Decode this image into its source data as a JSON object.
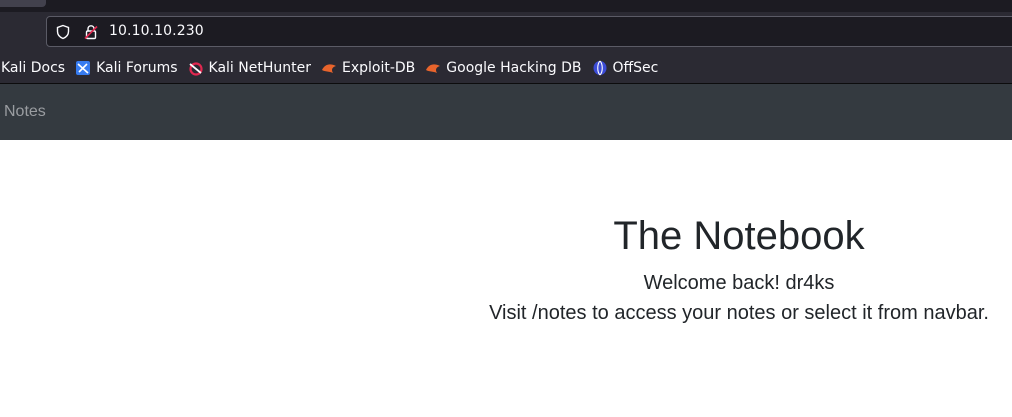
{
  "browser": {
    "url": "10.10.10.230",
    "bookmarks": [
      {
        "label": "Kali Docs",
        "icon": "kali-icon"
      },
      {
        "label": "Kali Forums",
        "icon": "kali-forums-icon"
      },
      {
        "label": "Kali NetHunter",
        "icon": "nethunter-icon"
      },
      {
        "label": "Exploit-DB",
        "icon": "exploit-db-icon"
      },
      {
        "label": "Google Hacking DB",
        "icon": "ghdb-icon"
      },
      {
        "label": "OffSec",
        "icon": "offsec-icon"
      }
    ]
  },
  "navbar": {
    "notes_label": "Notes"
  },
  "main": {
    "title": "The Notebook",
    "welcome": "Welcome back! dr4ks",
    "hint": "Visit /notes to access your notes or select it from navbar."
  },
  "colors": {
    "chrome": "#2b2a33",
    "navbar": "#343a40",
    "text": "#212529"
  }
}
